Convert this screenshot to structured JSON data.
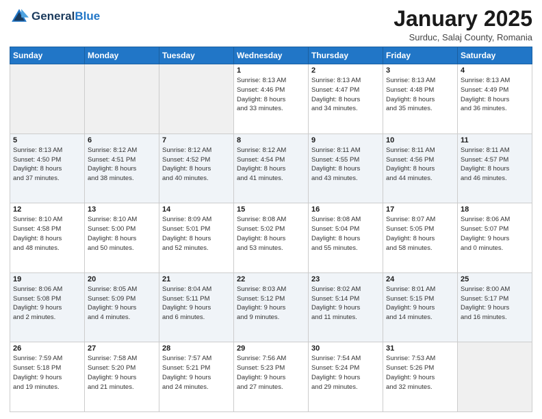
{
  "header": {
    "logo_general": "General",
    "logo_blue": "Blue",
    "month_title": "January 2025",
    "location": "Surduc, Salaj County, Romania"
  },
  "days_of_week": [
    "Sunday",
    "Monday",
    "Tuesday",
    "Wednesday",
    "Thursday",
    "Friday",
    "Saturday"
  ],
  "weeks": [
    [
      {
        "day": "",
        "info": ""
      },
      {
        "day": "",
        "info": ""
      },
      {
        "day": "",
        "info": ""
      },
      {
        "day": "1",
        "info": "Sunrise: 8:13 AM\nSunset: 4:46 PM\nDaylight: 8 hours\nand 33 minutes."
      },
      {
        "day": "2",
        "info": "Sunrise: 8:13 AM\nSunset: 4:47 PM\nDaylight: 8 hours\nand 34 minutes."
      },
      {
        "day": "3",
        "info": "Sunrise: 8:13 AM\nSunset: 4:48 PM\nDaylight: 8 hours\nand 35 minutes."
      },
      {
        "day": "4",
        "info": "Sunrise: 8:13 AM\nSunset: 4:49 PM\nDaylight: 8 hours\nand 36 minutes."
      }
    ],
    [
      {
        "day": "5",
        "info": "Sunrise: 8:13 AM\nSunset: 4:50 PM\nDaylight: 8 hours\nand 37 minutes."
      },
      {
        "day": "6",
        "info": "Sunrise: 8:12 AM\nSunset: 4:51 PM\nDaylight: 8 hours\nand 38 minutes."
      },
      {
        "day": "7",
        "info": "Sunrise: 8:12 AM\nSunset: 4:52 PM\nDaylight: 8 hours\nand 40 minutes."
      },
      {
        "day": "8",
        "info": "Sunrise: 8:12 AM\nSunset: 4:54 PM\nDaylight: 8 hours\nand 41 minutes."
      },
      {
        "day": "9",
        "info": "Sunrise: 8:11 AM\nSunset: 4:55 PM\nDaylight: 8 hours\nand 43 minutes."
      },
      {
        "day": "10",
        "info": "Sunrise: 8:11 AM\nSunset: 4:56 PM\nDaylight: 8 hours\nand 44 minutes."
      },
      {
        "day": "11",
        "info": "Sunrise: 8:11 AM\nSunset: 4:57 PM\nDaylight: 8 hours\nand 46 minutes."
      }
    ],
    [
      {
        "day": "12",
        "info": "Sunrise: 8:10 AM\nSunset: 4:58 PM\nDaylight: 8 hours\nand 48 minutes."
      },
      {
        "day": "13",
        "info": "Sunrise: 8:10 AM\nSunset: 5:00 PM\nDaylight: 8 hours\nand 50 minutes."
      },
      {
        "day": "14",
        "info": "Sunrise: 8:09 AM\nSunset: 5:01 PM\nDaylight: 8 hours\nand 52 minutes."
      },
      {
        "day": "15",
        "info": "Sunrise: 8:08 AM\nSunset: 5:02 PM\nDaylight: 8 hours\nand 53 minutes."
      },
      {
        "day": "16",
        "info": "Sunrise: 8:08 AM\nSunset: 5:04 PM\nDaylight: 8 hours\nand 55 minutes."
      },
      {
        "day": "17",
        "info": "Sunrise: 8:07 AM\nSunset: 5:05 PM\nDaylight: 8 hours\nand 58 minutes."
      },
      {
        "day": "18",
        "info": "Sunrise: 8:06 AM\nSunset: 5:07 PM\nDaylight: 9 hours\nand 0 minutes."
      }
    ],
    [
      {
        "day": "19",
        "info": "Sunrise: 8:06 AM\nSunset: 5:08 PM\nDaylight: 9 hours\nand 2 minutes."
      },
      {
        "day": "20",
        "info": "Sunrise: 8:05 AM\nSunset: 5:09 PM\nDaylight: 9 hours\nand 4 minutes."
      },
      {
        "day": "21",
        "info": "Sunrise: 8:04 AM\nSunset: 5:11 PM\nDaylight: 9 hours\nand 6 minutes."
      },
      {
        "day": "22",
        "info": "Sunrise: 8:03 AM\nSunset: 5:12 PM\nDaylight: 9 hours\nand 9 minutes."
      },
      {
        "day": "23",
        "info": "Sunrise: 8:02 AM\nSunset: 5:14 PM\nDaylight: 9 hours\nand 11 minutes."
      },
      {
        "day": "24",
        "info": "Sunrise: 8:01 AM\nSunset: 5:15 PM\nDaylight: 9 hours\nand 14 minutes."
      },
      {
        "day": "25",
        "info": "Sunrise: 8:00 AM\nSunset: 5:17 PM\nDaylight: 9 hours\nand 16 minutes."
      }
    ],
    [
      {
        "day": "26",
        "info": "Sunrise: 7:59 AM\nSunset: 5:18 PM\nDaylight: 9 hours\nand 19 minutes."
      },
      {
        "day": "27",
        "info": "Sunrise: 7:58 AM\nSunset: 5:20 PM\nDaylight: 9 hours\nand 21 minutes."
      },
      {
        "day": "28",
        "info": "Sunrise: 7:57 AM\nSunset: 5:21 PM\nDaylight: 9 hours\nand 24 minutes."
      },
      {
        "day": "29",
        "info": "Sunrise: 7:56 AM\nSunset: 5:23 PM\nDaylight: 9 hours\nand 27 minutes."
      },
      {
        "day": "30",
        "info": "Sunrise: 7:54 AM\nSunset: 5:24 PM\nDaylight: 9 hours\nand 29 minutes."
      },
      {
        "day": "31",
        "info": "Sunrise: 7:53 AM\nSunset: 5:26 PM\nDaylight: 9 hours\nand 32 minutes."
      },
      {
        "day": "",
        "info": ""
      }
    ]
  ]
}
